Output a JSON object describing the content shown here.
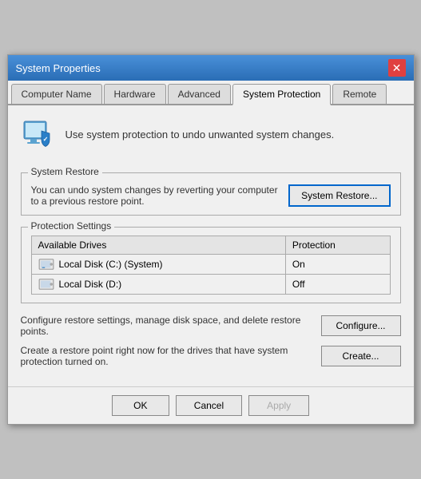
{
  "window": {
    "title": "System Properties",
    "close_label": "✕"
  },
  "tabs": [
    {
      "id": "computer-name",
      "label": "Computer Name",
      "active": false
    },
    {
      "id": "hardware",
      "label": "Hardware",
      "active": false
    },
    {
      "id": "advanced",
      "label": "Advanced",
      "active": false
    },
    {
      "id": "system-protection",
      "label": "System Protection",
      "active": true
    },
    {
      "id": "remote",
      "label": "Remote",
      "active": false
    }
  ],
  "top_description": "Use system protection to undo unwanted system changes.",
  "system_restore_group": {
    "label": "System Restore",
    "description": "You can undo system changes by reverting your computer to a previous restore point.",
    "button_label": "System Restore..."
  },
  "protection_settings_group": {
    "label": "Protection Settings",
    "table": {
      "headers": [
        "Available Drives",
        "Protection"
      ],
      "rows": [
        {
          "drive": "Local Disk (C:) (System)",
          "protection": "On",
          "icon_type": "system-drive"
        },
        {
          "drive": "Local Disk (D:)",
          "protection": "Off",
          "icon_type": "drive"
        }
      ]
    }
  },
  "configure_section": {
    "description": "Configure restore settings, manage disk space, and delete restore points.",
    "button_label": "Configure..."
  },
  "create_section": {
    "description": "Create a restore point right now for the drives that have system protection turned on.",
    "button_label": "Create..."
  },
  "bottom_buttons": {
    "ok": "OK",
    "cancel": "Cancel",
    "apply": "Apply"
  }
}
